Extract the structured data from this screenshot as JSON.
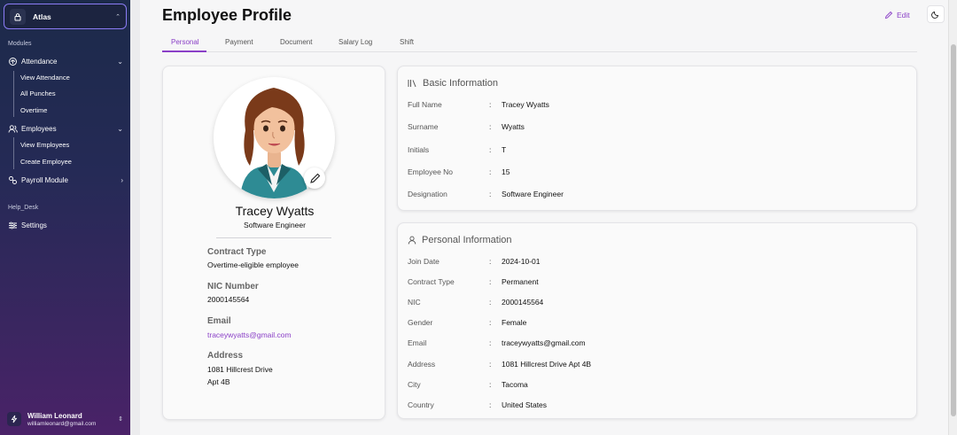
{
  "sidebar": {
    "org_name": "Atlas",
    "modules_label": "Modules",
    "attendance": {
      "label": "Attendance",
      "items": [
        "View Attendance",
        "All Punches",
        "Overtime"
      ]
    },
    "employees": {
      "label": "Employees",
      "items": [
        "View Employees",
        "Create Employee"
      ]
    },
    "payroll": {
      "label": "Payroll Module"
    },
    "helpdesk_label": "Help_Desk",
    "settings": {
      "label": "Settings"
    },
    "user": {
      "name": "William Leonard",
      "email": "williamleonard@gmail.com"
    }
  },
  "header": {
    "title": "Employee Profile",
    "edit_label": "Edit",
    "tabs": [
      "Personal",
      "Payment",
      "Document",
      "Salary Log",
      "Shift"
    ],
    "active_tab": "Personal"
  },
  "profile": {
    "name": "Tracey Wyatts",
    "designation": "Software Engineer",
    "contract_type_label": "Contract Type",
    "contract_type": "Overtime-eligible employee",
    "nic_label": "NIC Number",
    "nic": "2000145564",
    "email_label": "Email",
    "email": "traceywyatts@gmail.com",
    "address_label": "Address",
    "address_line1": "1081 Hillcrest Drive",
    "address_line2": "Apt 4B"
  },
  "basic_info": {
    "title": "Basic Information",
    "rows": [
      {
        "label": "Full Name",
        "value": "Tracey Wyatts"
      },
      {
        "label": "Surname",
        "value": "Wyatts"
      },
      {
        "label": "Initials",
        "value": "T"
      },
      {
        "label": "Employee No",
        "value": "15"
      },
      {
        "label": "Designation",
        "value": "Software Engineer"
      }
    ]
  },
  "personal_info": {
    "title": "Personal Information",
    "rows": [
      {
        "label": "Join Date",
        "value": "2024-10-01"
      },
      {
        "label": "Contract Type",
        "value": "Permanent"
      },
      {
        "label": "NIC",
        "value": "2000145564"
      },
      {
        "label": "Gender",
        "value": "Female"
      },
      {
        "label": "Email",
        "value": "traceywyatts@gmail.com"
      },
      {
        "label": "Address",
        "value": "1081 Hillcrest Drive Apt 4B"
      },
      {
        "label": "City",
        "value": "Tacoma"
      },
      {
        "label": "Country",
        "value": "United States"
      }
    ]
  },
  "separator": ":",
  "colors": {
    "accent": "#8a3fc7",
    "sidebar_top": "#1c2a4a",
    "sidebar_bottom": "#4a2268"
  },
  "icons": {
    "org": "lock-icon",
    "attendance": "fingerprint-icon",
    "employees": "users-icon",
    "payroll": "wallet-icon",
    "settings": "sliders-icon",
    "user": "bolt-icon",
    "edit": "pencil-icon",
    "theme": "moon-icon",
    "basic_info": "library-icon",
    "personal_info": "user-icon"
  }
}
